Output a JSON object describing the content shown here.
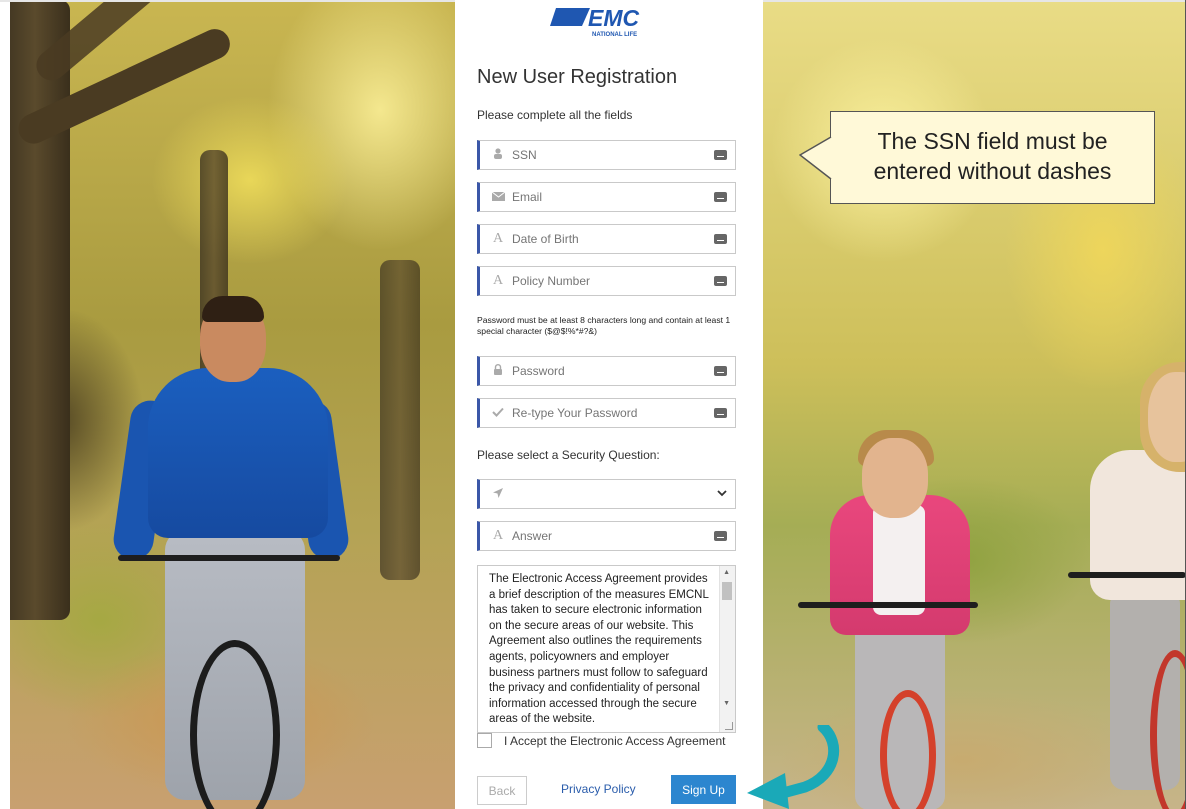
{
  "logo": {
    "brand": "EMC",
    "subtext": "NATIONAL LIFE",
    "color": "#1f57b1"
  },
  "form": {
    "title": "New User Registration",
    "subtitle": "Please complete all the fields",
    "fields": {
      "ssn": {
        "placeholder": "SSN",
        "icon": "user-icon"
      },
      "email": {
        "placeholder": "Email",
        "icon": "envelope-icon"
      },
      "dob": {
        "placeholder": "Date of Birth",
        "icon": "text-icon"
      },
      "policy": {
        "placeholder": "Policy Number",
        "icon": "text-icon"
      },
      "password": {
        "placeholder": "Password",
        "icon": "lock-icon"
      },
      "retype": {
        "placeholder": "Re-type Your Password",
        "icon": "check-icon"
      },
      "answer": {
        "placeholder": "Answer",
        "icon": "text-icon"
      }
    },
    "password_note": "Password must be at least 8 characters long and contain at least 1 special character ($@$!%*#?&)",
    "security_label": "Please select a Security Question:",
    "security_selected": "",
    "agreement_text": "The Electronic Access Agreement provides a brief description of the measures EMCNL has taken to secure electronic information on the secure areas of our website.  This Agreement also outlines the requirements agents, policyowners and employer business partners must follow to safeguard the privacy and confidentiality of personal information accessed through the secure areas of the website.",
    "accept_label": "I Accept the Electronic Access Agreement",
    "back_label": "Back",
    "privacy_label": "Privacy Policy",
    "signup_label": "Sign Up",
    "accent": "#3b57a8",
    "button_color": "#2c86cf"
  },
  "callout": {
    "text_line1": "The SSN field must be",
    "text_line2": "entered without dashes",
    "background": "#fff9d8"
  },
  "arrow": {
    "color": "#1aa9b8"
  }
}
